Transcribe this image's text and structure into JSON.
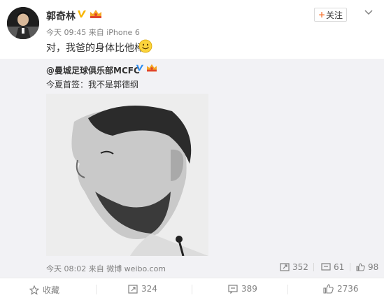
{
  "post": {
    "author": "郭奇林",
    "meta": "今天 09:45 来自 iPhone 6",
    "text": "对，我爸的身体比他棒",
    "follow_label": "关注"
  },
  "repost": {
    "author": "@曼城足球俱乐部MCFC",
    "text": "今夏首签：我不是郭德纲",
    "meta": "今天 08:02 来自 微博 weibo.com",
    "stats": {
      "reposts": "352",
      "comments": "61",
      "likes": "98"
    }
  },
  "actions": {
    "favorite": "收藏",
    "repost": "324",
    "comment": "389",
    "like": "2736"
  },
  "colors": {
    "accent": "#f77c3d",
    "verified": "#f7b500",
    "repost_bg": "#f2f2f5",
    "meta_text": "#808080"
  }
}
